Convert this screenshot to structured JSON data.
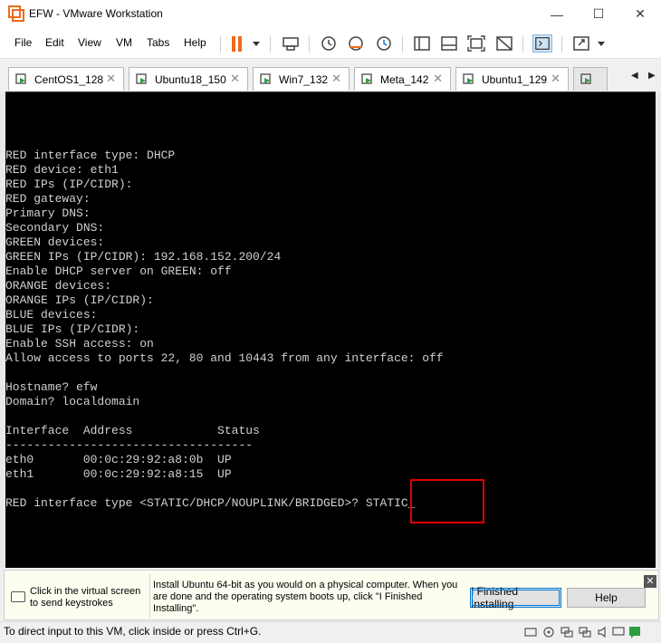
{
  "window": {
    "title": "EFW - VMware Workstation",
    "minimize_glyph": "—",
    "maximize_glyph": "☐",
    "close_glyph": "✕"
  },
  "menu": {
    "items": [
      "File",
      "Edit",
      "View",
      "VM",
      "Tabs",
      "Help"
    ]
  },
  "toolbar": {
    "icons": [
      "pause-icon",
      "send-ctrl-alt-del-icon",
      "snapshot-icon",
      "revert-snapshot-icon",
      "snapshot-manager-icon",
      "library-icon",
      "thumbnail-icon",
      "fullscreen-icon",
      "unity-icon",
      "console-view-icon",
      "stretch-icon"
    ],
    "accent_color": "#ee6b1e"
  },
  "tabs": [
    {
      "label": "CentOS1_128",
      "close": "✕"
    },
    {
      "label": "Ubuntu18_150",
      "close": "✕"
    },
    {
      "label": "Win7_132",
      "close": "✕"
    },
    {
      "label": "Meta_142",
      "close": "✕"
    },
    {
      "label": "Ubuntu1_129",
      "close": "✕"
    },
    {
      "label": "",
      "close": ""
    }
  ],
  "tab_nav": {
    "prev": "◀",
    "next": "▶"
  },
  "console": {
    "lines": [
      "RED interface type: DHCP",
      "RED device: eth1",
      "RED IPs (IP/CIDR):",
      "RED gateway:",
      "Primary DNS:",
      "Secondary DNS:",
      "GREEN devices:",
      "GREEN IPs (IP/CIDR): 192.168.152.200/24",
      "Enable DHCP server on GREEN: off",
      "ORANGE devices:",
      "ORANGE IPs (IP/CIDR):",
      "BLUE devices:",
      "BLUE IPs (IP/CIDR):",
      "Enable SSH access: on",
      "Allow access to ports 22, 80 and 10443 from any interface: off",
      "",
      "Hostname? efw",
      "Domain? localdomain",
      "",
      "Interface  Address            Status",
      "-----------------------------------",
      "eth0       00:0c:29:92:a8:0b  UP",
      "eth1       00:0c:29:92:a8:15  UP",
      "",
      "RED interface type <STATIC/DHCP/NOUPLINK/BRIDGED>? STATIC_"
    ],
    "highlight_color": "#e00000"
  },
  "infobar": {
    "left_text": "Click in the virtual screen to send keystrokes",
    "main_text": "Install Ubuntu 64-bit as you would on a physical computer. When you are done and the operating system boots up, click \"I Finished Installing\".",
    "finished_button": "I Finished Installing",
    "help_button": "Help",
    "close_glyph": "✕"
  },
  "statusbar": {
    "text": "To direct input to this VM, click inside or press Ctrl+G."
  }
}
